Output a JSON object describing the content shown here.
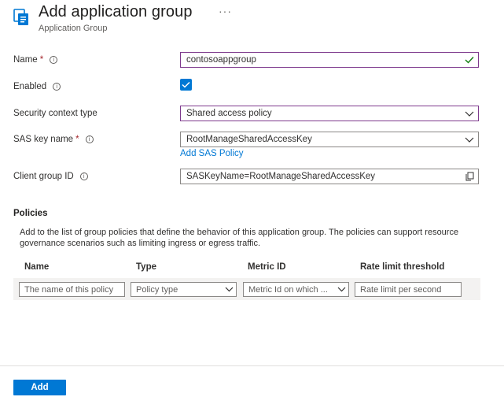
{
  "header": {
    "title": "Add application group",
    "subtitle": "Application Group",
    "more": "···",
    "icon": "application-group-icon"
  },
  "form": {
    "name": {
      "label": "Name",
      "required": "*",
      "value": "contosoappgroup",
      "status_icon": "checkmark-icon"
    },
    "enabled": {
      "label": "Enabled",
      "checked": true
    },
    "security_context_type": {
      "label": "Security context type",
      "value": "Shared access policy"
    },
    "sas_key_name": {
      "label": "SAS key name",
      "required": "*",
      "value": "RootManageSharedAccessKey",
      "link": "Add SAS Policy"
    },
    "client_group_id": {
      "label": "Client group ID",
      "value": "SASKeyName=RootManageSharedAccessKey",
      "action_icon": "copy-icon"
    },
    "info_glyph": "i"
  },
  "policies": {
    "title": "Policies",
    "description": "Add to the list of group policies that define the behavior of this application group. The policies can support resource governance scenarios such as limiting ingress or egress traffic.",
    "columns": [
      "Name",
      "Type",
      "Metric ID",
      "Rate limit threshold"
    ],
    "row": {
      "name_placeholder": "The name of this policy",
      "type_placeholder": "Policy type",
      "metric_placeholder": "Metric Id on which ...",
      "rate_placeholder": "Rate limit per second"
    }
  },
  "footer": {
    "add_label": "Add"
  },
  "colors": {
    "accent": "#0078d4",
    "focus_border": "#7e3a8d",
    "valid": "#107c10",
    "required": "#a4262c"
  }
}
